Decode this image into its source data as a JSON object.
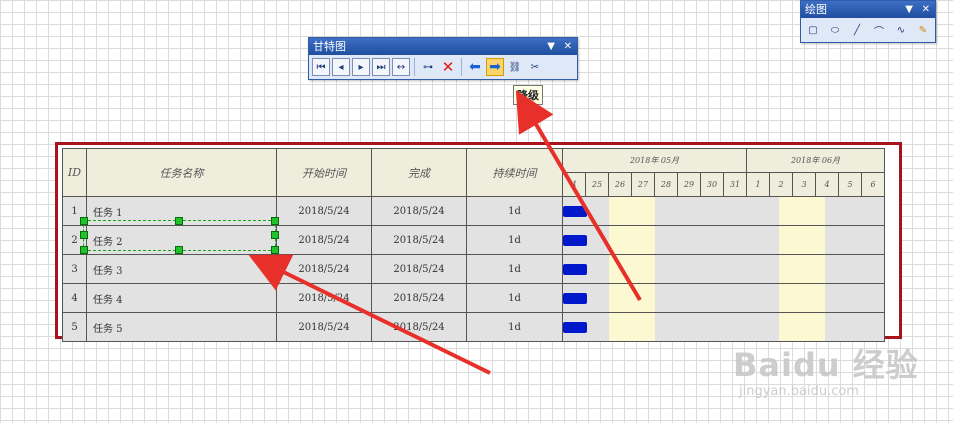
{
  "gantt_toolbar": {
    "title": "甘特图",
    "dropdown": "▼",
    "close": "✕",
    "buttons": [
      "first",
      "previous",
      "next",
      "last",
      "fit",
      "link-task",
      "delete",
      "promote",
      "demote",
      "link",
      "unlink"
    ]
  },
  "draw_toolbar": {
    "title": "绘图",
    "dropdown": "▼",
    "close": "✕",
    "buttons": [
      "rectangle",
      "ellipse",
      "line",
      "arc",
      "freeform",
      "pencil"
    ]
  },
  "tooltip": "降级",
  "gantt": {
    "headers": {
      "id": "ID",
      "name": "任务名称",
      "start": "开始时间",
      "finish": "完成",
      "duration": "持续时间"
    },
    "months": [
      {
        "label": "2018年 05月"
      },
      {
        "label": "2018年 06月"
      }
    ],
    "days": [
      "4",
      "25",
      "26",
      "27",
      "28",
      "29",
      "30",
      "31",
      "1",
      "2",
      "3",
      "4",
      "5",
      "6"
    ],
    "rows": [
      {
        "id": "1",
        "name": "任务 1",
        "start": "2018/5/24",
        "finish": "2018/5/24",
        "duration": "1d"
      },
      {
        "id": "2",
        "name": "任务 2",
        "start": "2018/5/24",
        "finish": "2018/5/24",
        "duration": "1d"
      },
      {
        "id": "3",
        "name": "任务 3",
        "start": "2018/5/24",
        "finish": "2018/5/24",
        "duration": "1d"
      },
      {
        "id": "4",
        "name": "任务 4",
        "start": "2018/5/24",
        "finish": "2018/5/24",
        "duration": "1d"
      },
      {
        "id": "5",
        "name": "任务 5",
        "start": "2018/5/24",
        "finish": "2018/5/24",
        "duration": "1d"
      }
    ]
  },
  "watermark": {
    "main": "Baidu 经验",
    "sub": "jingyan.baidu.com"
  },
  "colors": {
    "frame": "#a8141c",
    "bar": "#0018cc",
    "weekend": "#fbf8d2",
    "arrow": "#e8302a"
  }
}
